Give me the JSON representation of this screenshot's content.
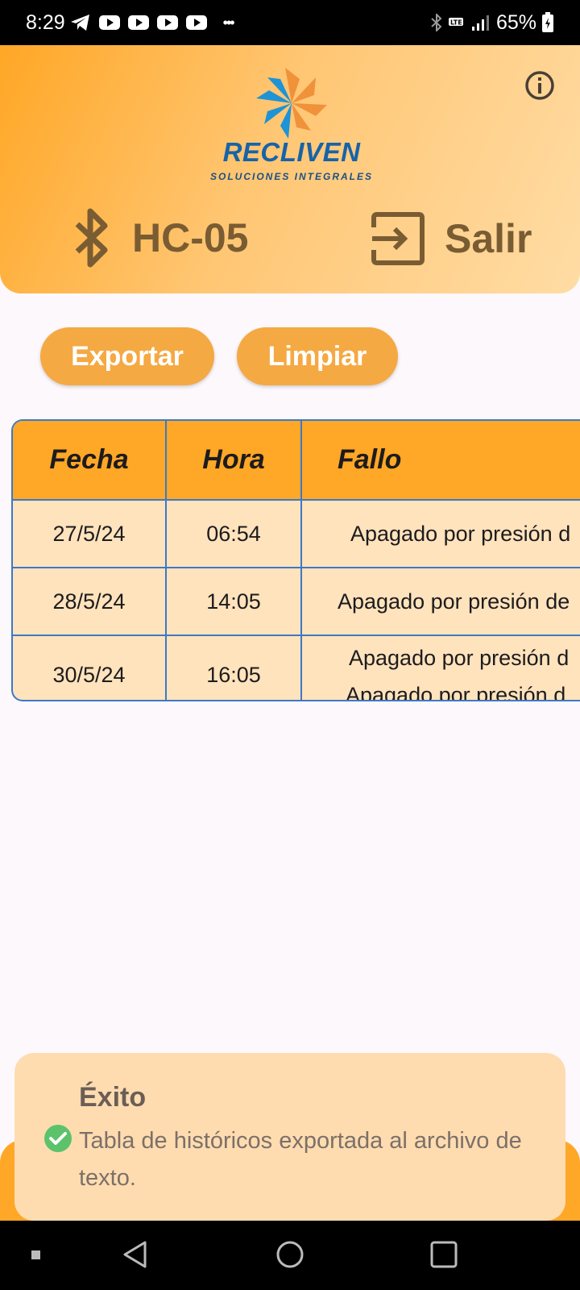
{
  "status_bar": {
    "time": "8:29",
    "battery": "65%",
    "icons": [
      "telegram-icon",
      "youtube-icon",
      "youtube-icon",
      "youtube-icon",
      "youtube-icon",
      "more-icon",
      "bluetooth-icon",
      "lte-icon",
      "signal-icon",
      "battery-icon"
    ]
  },
  "header": {
    "logo_text": "RECLIVEN",
    "logo_subtitle": "SOLUCIONES INTEGRALES",
    "device_name": "HC-05",
    "logout_label": "Salir",
    "colors": {
      "gradient_start": "#ffa726",
      "gradient_end": "#ffdca5",
      "text": "#7a5c33"
    }
  },
  "actions": {
    "export_label": "Exportar",
    "clear_label": "Limpiar",
    "button_color": "#f5a942"
  },
  "table": {
    "headers": {
      "date": "Fecha",
      "time": "Hora",
      "fault": "Fallo"
    },
    "rows": [
      {
        "date": "27/5/24",
        "time": "06:54",
        "fault": [
          "Apagado por presión d"
        ]
      },
      {
        "date": "28/5/24",
        "time": "14:05",
        "fault": [
          "Apagado por presión de"
        ]
      },
      {
        "date": "30/5/24",
        "time": "16:05",
        "fault": [
          "Apagado por presión d",
          "Apagado por presión d"
        ]
      }
    ],
    "border_color": "#3d78c8",
    "header_color": "#ffa726",
    "row_color": "#ffe3bc"
  },
  "toast": {
    "title": "Éxito",
    "message": "Tabla de históricos exportada al archivo de texto.",
    "icon": "check-circle-icon",
    "success_color": "#5cc26b"
  },
  "nav_bar": {
    "icons": [
      "recents-dot-icon",
      "back-icon",
      "home-icon",
      "overview-icon"
    ]
  }
}
